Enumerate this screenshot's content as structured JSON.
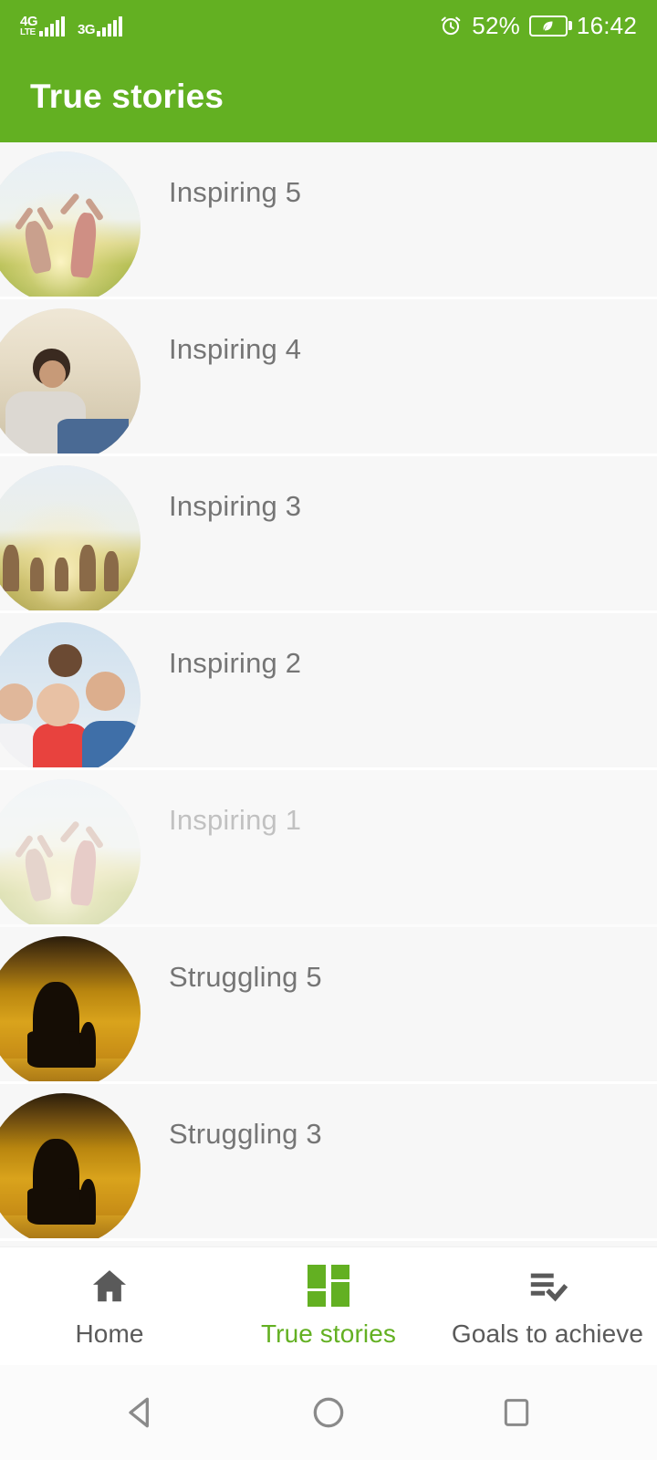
{
  "status_bar": {
    "networks": [
      {
        "tag": "4G",
        "sub": "LTE",
        "icon": "signal-bars-icon"
      },
      {
        "tag": "3G",
        "sub": "",
        "icon": "signal-bars-icon"
      }
    ],
    "alarm_icon": "alarm-clock-icon",
    "battery_percent": "52%",
    "battery_icon": "battery-saver-leaf-icon",
    "time": "16:42"
  },
  "app_bar": {
    "title": "True stories",
    "background": "#63b022"
  },
  "list": {
    "items": [
      {
        "label": "Inspiring 5",
        "art": "jump",
        "faded": false
      },
      {
        "label": "Inspiring 4",
        "art": "man",
        "faded": false
      },
      {
        "label": "Inspiring 3",
        "art": "family",
        "faded": false
      },
      {
        "label": "Inspiring 2",
        "art": "portrait",
        "faded": false
      },
      {
        "label": "Inspiring 1",
        "art": "jump",
        "faded": true
      },
      {
        "label": "Struggling 5",
        "art": "sitting",
        "faded": false
      },
      {
        "label": "Struggling 3",
        "art": "sitting",
        "faded": false
      },
      {
        "label": "",
        "art": "portrait",
        "faded": false
      }
    ]
  },
  "bottom_nav": {
    "active_color": "#63b022",
    "inactive_color": "#5a5a5a",
    "items": [
      {
        "label": "Home",
        "icon": "home-icon",
        "active": false
      },
      {
        "label": "True stories",
        "icon": "dashboard-grid-icon",
        "active": true
      },
      {
        "label": "Goals to achieve",
        "icon": "playlist-check-icon",
        "active": false
      }
    ]
  },
  "system_nav": {
    "back": "back-triangle-icon",
    "home": "home-circle-icon",
    "recents": "recents-square-icon"
  }
}
